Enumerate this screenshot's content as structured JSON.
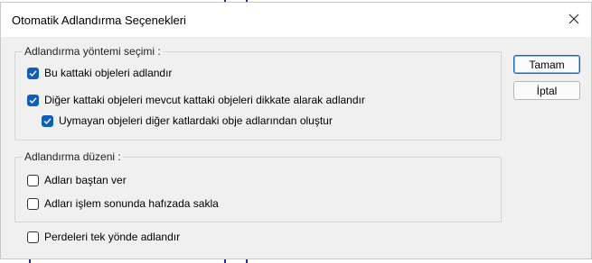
{
  "dialog": {
    "title": "Otomatik Adlandırma Seçenekleri"
  },
  "method_group": {
    "title": "Adlandırma yöntemi seçimi :",
    "options": [
      {
        "label": "Bu kattaki objeleri adlandır",
        "checked": true
      },
      {
        "label": "Diğer kattaki objeleri mevcut kattaki objeleri dikkate alarak adlandır",
        "checked": true
      },
      {
        "label": "Uymayan objeleri diğer katlardaki obje adlarından oluştur",
        "checked": true
      }
    ]
  },
  "order_group": {
    "title": "Adlandırma düzeni :",
    "options": [
      {
        "label": "Adları baştan ver",
        "checked": false
      },
      {
        "label": "Adları işlem sonunda hafızada sakla",
        "checked": false
      }
    ]
  },
  "walls_option": {
    "label": "Perdeleri tek yönde adlandır",
    "checked": false
  },
  "buttons": {
    "ok": "Tamam",
    "cancel": "İptal"
  },
  "colors": {
    "accent": "#0f5fb8"
  }
}
